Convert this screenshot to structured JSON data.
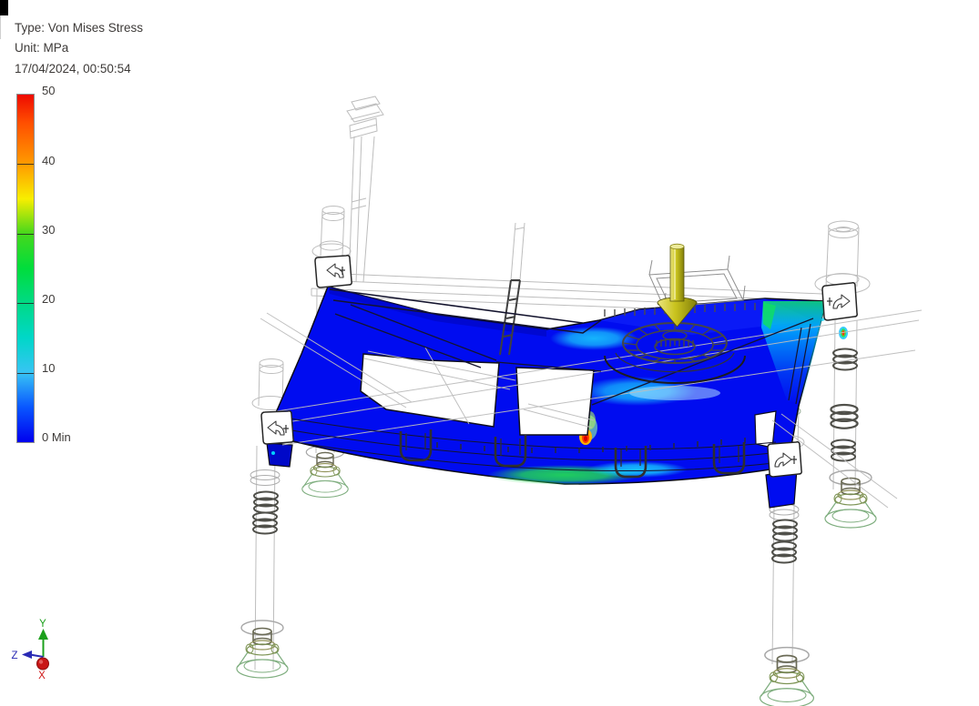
{
  "header": {
    "type_label": "Type: Von Mises Stress",
    "unit_label": "Unit: MPa",
    "timestamp": "17/04/2024, 00:50:54",
    "text_color": "#3d3a38"
  },
  "legend": {
    "ticks": [
      "50",
      "40",
      "30",
      "20",
      "10"
    ],
    "min_label": "0 Min",
    "gradient": [
      {
        "pos": 0,
        "color": "#ee0a00"
      },
      {
        "pos": 8,
        "color": "#ff4e00"
      },
      {
        "pos": 20,
        "color": "#ff9b00"
      },
      {
        "pos": 30,
        "color": "#f8ee00"
      },
      {
        "pos": 40,
        "color": "#46d81c"
      },
      {
        "pos": 50,
        "color": "#00dd3c"
      },
      {
        "pos": 60,
        "color": "#00da86"
      },
      {
        "pos": 70,
        "color": "#00d7c8"
      },
      {
        "pos": 80,
        "color": "#38c4f4"
      },
      {
        "pos": 90,
        "color": "#0956ff"
      },
      {
        "pos": 100,
        "color": "#0000ee"
      }
    ]
  },
  "triad": {
    "x_label": "X",
    "y_label": "Y",
    "z_label": "Z",
    "x_color": "#cf1616",
    "y_color": "#1ca01c",
    "z_color": "#2a2ab4"
  },
  "scene": {
    "stress_low_color": "#000cf0",
    "wireframe_color": "#bdbdbd",
    "mesh_color": "#3f3f3f",
    "foot_color": "#7fae7f",
    "force_arrow_color": "#c9c31e",
    "corner_mark_color": "#000000"
  }
}
